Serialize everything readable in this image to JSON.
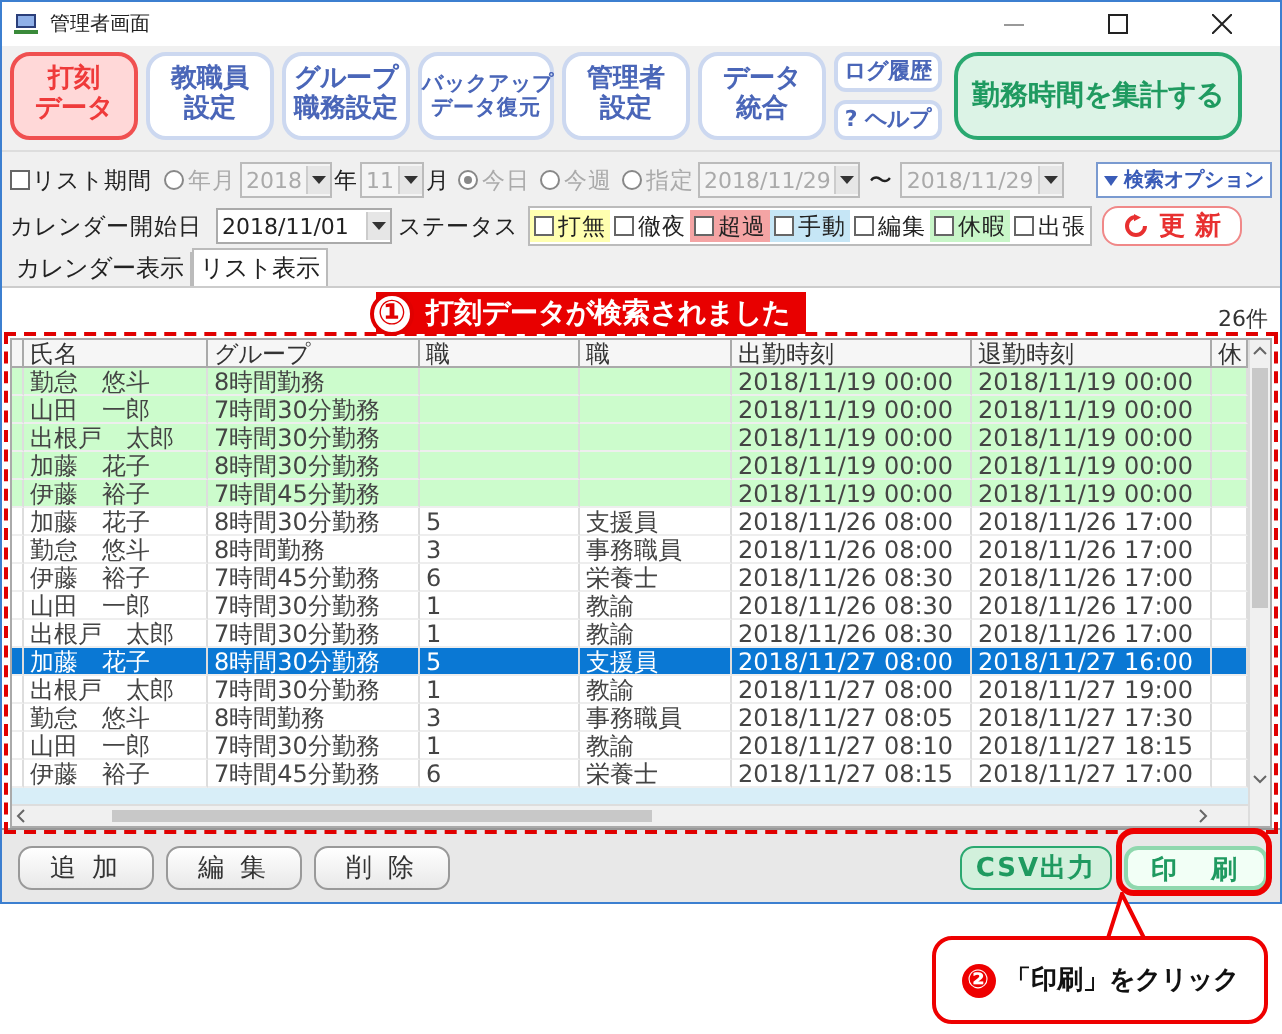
{
  "window": {
    "title": "管理者画面"
  },
  "toolbar": [
    {
      "lines": [
        "打刻",
        "データ"
      ],
      "kind": "nav",
      "selected": true
    },
    {
      "lines": [
        "教職員",
        "設定"
      ],
      "kind": "nav",
      "selected": false
    },
    {
      "lines": [
        "グループ",
        "職務設定"
      ],
      "kind": "nav",
      "selected": false
    },
    {
      "lines": [
        "バックアップ",
        "データ復元"
      ],
      "kind": "nav",
      "selected": false
    },
    {
      "lines": [
        "管理者",
        "設定"
      ],
      "kind": "nav",
      "selected": false
    },
    {
      "lines": [
        "データ",
        "統合"
      ],
      "kind": "nav",
      "selected": false
    },
    {
      "lines": [
        "ログ履歴"
      ],
      "kind": "small",
      "selected": false
    },
    {
      "lines": [
        "? ヘルプ"
      ],
      "kind": "small",
      "selected": false
    },
    {
      "lines": [
        "勤務時間を集計する"
      ],
      "kind": "summary",
      "selected": false
    }
  ],
  "period": {
    "label": "リスト期間",
    "checked": false,
    "disabled": true,
    "options": [
      {
        "label": "年月",
        "selected": false
      },
      {
        "label": "今日",
        "selected": true
      },
      {
        "label": "今週",
        "selected": false
      },
      {
        "label": "指定",
        "selected": false
      }
    ],
    "year": "2018",
    "year_unit": "年",
    "month": "11",
    "month_unit": "月",
    "from": "2018/11/29",
    "separator": "〜",
    "to": "2018/11/29"
  },
  "search_options": "検索オプション",
  "calendar_start": {
    "label": "カレンダー開始日",
    "value": "2018/11/01"
  },
  "status": {
    "label": "ステータス",
    "items": [
      {
        "label": "打無",
        "checked": false,
        "color": "#ffffb0"
      },
      {
        "label": "徹夜",
        "checked": false
      },
      {
        "label": "超過",
        "checked": false,
        "color": "#f4a4a4"
      },
      {
        "label": "手動",
        "checked": false,
        "color": "#c6e6f6"
      },
      {
        "label": "編集",
        "checked": false
      },
      {
        "label": "休暇",
        "checked": false,
        "color": "#c8f6c8"
      },
      {
        "label": "出張",
        "checked": false
      }
    ]
  },
  "refresh": "更 新",
  "tabs": [
    {
      "label": "カレンダー表示",
      "selected": false
    },
    {
      "label": "リスト表示",
      "selected": true
    }
  ],
  "count": "26件",
  "table": {
    "columns": [
      {
        "label": "氏名"
      },
      {
        "label": "グループ"
      },
      {
        "label": "職"
      },
      {
        "label": "職"
      },
      {
        "label": "出勤時刻"
      },
      {
        "label": "退勤時刻"
      },
      {
        "label": "休"
      }
    ],
    "rows": [
      {
        "cells": [
          "勤怠　悠斗",
          "8時間勤務",
          null,
          null,
          "2018/11/19 00:00",
          "2018/11/19 00:00"
        ],
        "color": "#ccfccc",
        "selected": false
      },
      {
        "cells": [
          "山田　一郎",
          "7時間30分勤務",
          null,
          null,
          "2018/11/19 00:00",
          "2018/11/19 00:00"
        ],
        "color": "#ccfccc",
        "selected": false
      },
      {
        "cells": [
          "出根戸　太郎",
          "7時間30分勤務",
          null,
          null,
          "2018/11/19 00:00",
          "2018/11/19 00:00"
        ],
        "color": "#ccfccc",
        "selected": false
      },
      {
        "cells": [
          "加藤　花子",
          "8時間30分勤務",
          null,
          null,
          "2018/11/19 00:00",
          "2018/11/19 00:00"
        ],
        "color": "#ccfccc",
        "selected": false
      },
      {
        "cells": [
          "伊藤　裕子",
          "7時間45分勤務",
          null,
          null,
          "2018/11/19 00:00",
          "2018/11/19 00:00"
        ],
        "color": "#ccfccc",
        "selected": false
      },
      {
        "cells": [
          "加藤　花子",
          "8時間30分勤務",
          "5",
          "支援員",
          "2018/11/26 08:00",
          "2018/11/26 17:00"
        ],
        "selected": false
      },
      {
        "cells": [
          "勤怠　悠斗",
          "8時間勤務",
          "3",
          "事務職員",
          "2018/11/26 08:00",
          "2018/11/26 17:00"
        ],
        "selected": false
      },
      {
        "cells": [
          "伊藤　裕子",
          "7時間45分勤務",
          "6",
          "栄養士",
          "2018/11/26 08:30",
          "2018/11/26 17:00"
        ],
        "selected": false
      },
      {
        "cells": [
          "山田　一郎",
          "7時間30分勤務",
          "1",
          "教諭",
          "2018/11/26 08:30",
          "2018/11/26 17:00"
        ],
        "selected": false
      },
      {
        "cells": [
          "出根戸　太郎",
          "7時間30分勤務",
          "1",
          "教諭",
          "2018/11/26 08:30",
          "2018/11/26 17:00"
        ],
        "selected": false
      },
      {
        "cells": [
          "加藤　花子",
          "8時間30分勤務",
          "5",
          "支援員",
          "2018/11/27 08:00",
          "2018/11/27 16:00"
        ],
        "selected": true
      },
      {
        "cells": [
          "出根戸　太郎",
          "7時間30分勤務",
          "1",
          "教諭",
          "2018/11/27 08:00",
          "2018/11/27 19:00"
        ],
        "selected": false
      },
      {
        "cells": [
          "勤怠　悠斗",
          "8時間勤務",
          "3",
          "事務職員",
          "2018/11/27 08:05",
          "2018/11/27 17:30"
        ],
        "selected": false
      },
      {
        "cells": [
          "山田　一郎",
          "7時間30分勤務",
          "1",
          "教諭",
          "2018/11/27 08:10",
          "2018/11/27 18:15"
        ],
        "selected": false
      },
      {
        "cells": [
          "伊藤　裕子",
          "7時間45分勤務",
          "6",
          "栄養士",
          "2018/11/27 08:15",
          "2018/11/27 17:00"
        ],
        "selected": false
      }
    ]
  },
  "buttons": [
    {
      "label": "追 加",
      "kind": "plain"
    },
    {
      "label": "編 集",
      "kind": "plain"
    },
    {
      "label": "削 除",
      "kind": "plain"
    },
    {
      "label": "CSV出力",
      "kind": "green"
    },
    {
      "label": "印　刷",
      "kind": "outline"
    }
  ],
  "callouts": [
    {
      "number": "①",
      "text": "打刻データが検索されました"
    },
    {
      "number": "②",
      "text": "「印刷」をクリック"
    }
  ]
}
